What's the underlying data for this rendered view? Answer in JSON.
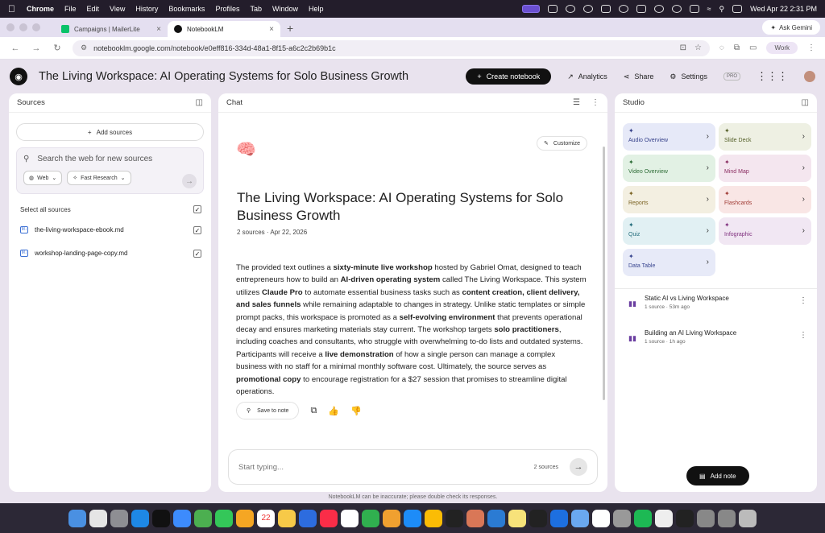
{
  "menubar": {
    "app": "Chrome",
    "items": [
      "File",
      "Edit",
      "View",
      "History",
      "Bookmarks",
      "Profiles",
      "Tab",
      "Window",
      "Help"
    ],
    "datetime": "Wed Apr 22  2:31 PM"
  },
  "tabs": [
    {
      "label": "Campaigns | MailerLite",
      "active": false,
      "favicon_color": "#09c269"
    },
    {
      "label": "NotebookLM",
      "active": true,
      "favicon_color": "#111111"
    }
  ],
  "ask_gemini": "Ask Gemini",
  "address": {
    "url": "notebooklm.google.com/notebook/e0eff816-334d-48a1-8f15-a6c2c2b69b1c",
    "profile": "Work"
  },
  "header": {
    "title": "The Living Workspace: AI Operating Systems for Solo Business Growth",
    "create_label": "Create notebook",
    "analytics_label": "Analytics",
    "share_label": "Share",
    "settings_label": "Settings",
    "pro_badge": "PRO"
  },
  "sources": {
    "title": "Sources",
    "add_label": "Add sources",
    "search_placeholder": "Search the web for new sources",
    "web_chip": "Web",
    "research_chip": "Fast Research",
    "select_all": "Select all sources",
    "items": [
      {
        "label": "the-living-workspace-ebook.md",
        "checked": true
      },
      {
        "label": "workshop-landing-page-copy.md",
        "checked": true
      }
    ]
  },
  "chat": {
    "title": "Chat",
    "customize_label": "Customize",
    "notebook_title": "The Living Workspace: AI Operating Systems for Solo Business Growth",
    "meta": "2 sources · Apr 22, 2026",
    "summary": [
      {
        "t": "The provided text outlines a ",
        "b": false
      },
      {
        "t": "sixty-minute live workshop",
        "b": true
      },
      {
        "t": " hosted by Gabriel Omat, designed to teach entrepreneurs how to build an ",
        "b": false
      },
      {
        "t": "AI-driven operating system",
        "b": true
      },
      {
        "t": " called The Living Workspace. This system utilizes ",
        "b": false
      },
      {
        "t": "Claude Pro",
        "b": true
      },
      {
        "t": " to automate essential business tasks such as ",
        "b": false
      },
      {
        "t": "content creation, client delivery, and sales funnels",
        "b": true
      },
      {
        "t": " while remaining adaptable to changes in strategy. Unlike static templates or simple prompt packs, this workspace is promoted as a ",
        "b": false
      },
      {
        "t": "self-evolving environment",
        "b": true
      },
      {
        "t": " that prevents operational decay and ensures marketing materials stay current. The workshop targets ",
        "b": false
      },
      {
        "t": "solo practitioners",
        "b": true
      },
      {
        "t": ", including coaches and consultants, who struggle with overwhelming to-do lists and outdated systems. Participants will receive a ",
        "b": false
      },
      {
        "t": "live demonstration",
        "b": true
      },
      {
        "t": " of how a single person can manage a complex business with no staff for a minimal monthly software cost. Ultimately, the source serves as ",
        "b": false
      },
      {
        "t": "promotional copy",
        "b": true
      },
      {
        "t": " to encourage registration for a $27 session that promises to streamline digital operations.",
        "b": false
      }
    ],
    "save_label": "Save to note",
    "input_placeholder": "Start typing...",
    "source_count": "2 sources",
    "disclaimer": "NotebookLM can be inaccurate; please double check its responses."
  },
  "studio": {
    "title": "Studio",
    "tiles": [
      {
        "label": "Audio Overview",
        "cls": "t-audio",
        "icon": "waveform-icon"
      },
      {
        "label": "Slide Deck",
        "cls": "t-slide",
        "icon": "slides-icon"
      },
      {
        "label": "Video Overview",
        "cls": "t-video",
        "icon": "video-icon"
      },
      {
        "label": "Mind Map",
        "cls": "t-mind",
        "icon": "mindmap-icon"
      },
      {
        "label": "Reports",
        "cls": "t-reports",
        "icon": "reports-icon"
      },
      {
        "label": "Flashcards",
        "cls": "t-flash",
        "icon": "flashcards-icon"
      },
      {
        "label": "Quiz",
        "cls": "t-quiz",
        "icon": "quiz-icon"
      },
      {
        "label": "Infographic",
        "cls": "t-info",
        "icon": "infographic-icon"
      },
      {
        "label": "Data Table",
        "cls": "t-data",
        "icon": "table-icon"
      }
    ],
    "notes": [
      {
        "title": "Static AI vs Living Workspace",
        "meta": "1 source · 53m ago"
      },
      {
        "title": "Building an AI Living Workspace",
        "meta": "1 source · 1h ago"
      }
    ],
    "add_note_label": "Add note"
  },
  "dock": {
    "apps": [
      "finder",
      "launchpad",
      "settings",
      "safari",
      "chatgpt",
      "mail",
      "maps",
      "messages",
      "photos",
      "calendar",
      "notes",
      "keynote",
      "music",
      "reminders",
      "numbers",
      "pages",
      "appstore",
      "chrome",
      "notebooklm",
      "anthropic",
      "vscode",
      "stickies",
      "terminal",
      "xcode",
      "preview",
      "capcut",
      "screenshot",
      "spotify",
      "textedit",
      "istat",
      "help",
      "help2",
      "trash"
    ],
    "calendar_day": "22"
  },
  "colors": {
    "accent_dark": "#111111",
    "page_bg": "#e9e3ee",
    "note_icon": "#6a3ea0"
  }
}
